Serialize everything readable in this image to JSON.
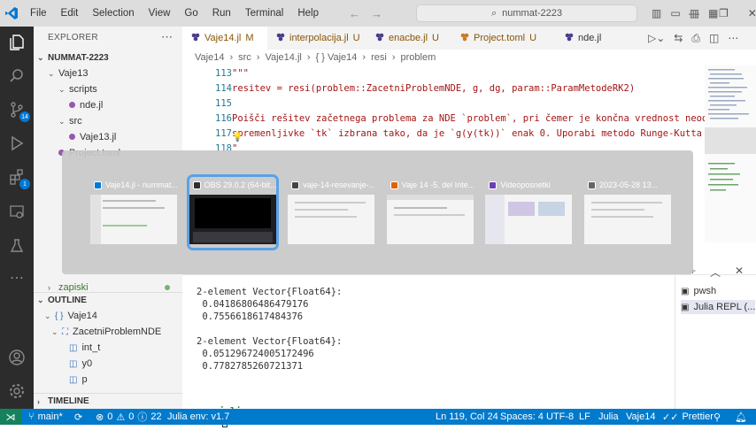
{
  "menu": [
    "File",
    "Edit",
    "Selection",
    "View",
    "Go",
    "Run",
    "Terminal",
    "Help"
  ],
  "search": {
    "text": "nummat-2223"
  },
  "explorer": {
    "title": "EXPLORER",
    "project": "NUMMAT-2223",
    "rows": [
      {
        "label": "Vaje13",
        "indent": 1,
        "arrow": "⌄"
      },
      {
        "label": "scripts",
        "indent": 2,
        "arrow": "⌄"
      },
      {
        "label": "nde.jl",
        "indent": 3,
        "arrow": ""
      },
      {
        "label": "src",
        "indent": 2,
        "arrow": "⌄"
      },
      {
        "label": "Vaje13.jl",
        "indent": 3,
        "arrow": ""
      },
      {
        "label": "Project.toml",
        "indent": 2,
        "arrow": ""
      }
    ],
    "zapiski": "zapiski",
    "outline_title": "OUTLINE",
    "outline": [
      {
        "label": "Vaje14",
        "indent": 1,
        "icon": "{ }"
      },
      {
        "label": "ZacetniProblemNDE",
        "indent": 2,
        "icon": "⛶"
      },
      {
        "label": "int_t",
        "indent": 3,
        "icon": "◫"
      },
      {
        "label": "y0",
        "indent": 3,
        "icon": "◫"
      },
      {
        "label": "p",
        "indent": 3,
        "icon": "◫"
      }
    ],
    "timeline": "TIMELINE"
  },
  "tabs": [
    {
      "label": "Vaje14.jl",
      "mark": "M",
      "active": true,
      "color": "#4a3b8c"
    },
    {
      "label": "interpolacija.jl",
      "mark": "U",
      "active": false,
      "color": "#4a3b8c"
    },
    {
      "label": "enacbe.jl",
      "mark": "U",
      "active": false,
      "color": "#4a3b8c"
    },
    {
      "label": "Project.toml",
      "mark": "U",
      "active": false,
      "color": "#c97b1e"
    },
    {
      "label": "nde.jl",
      "mark": "",
      "active": false,
      "color": "#4a3b8c"
    }
  ],
  "breadcrumb": [
    "Vaje14",
    "src",
    "Vaje14.jl",
    "{ } Vaje14",
    "resi",
    "problem"
  ],
  "code": [
    {
      "n": "113",
      "text": "\"\"\""
    },
    {
      "n": "114",
      "text": "    resitev = resi(problem::ZacetniProblemNDE, g, dg, param::ParamMetodeRK2)"
    },
    {
      "n": "115",
      "text": ""
    },
    {
      "n": "116",
      "text": "Poišči rešitev začetnega problema za NDE `problem`, pri čemer je končna vrednost neodvi"
    },
    {
      "n": "117",
      "text": "spremenljivke `tk` izbrana tako, da je `g(y(tk))` enak 0. Uporabi metodo Runge-Kutta re"
    },
    {
      "n": "118",
      "text": "\""
    }
  ],
  "switcher": [
    {
      "title": "Vaje14.jl - nummat...",
      "selected": false,
      "icon": "vscode"
    },
    {
      "title": "OBS 29.0.2 (64-bit...",
      "selected": true,
      "icon": "obs"
    },
    {
      "title": "vaje-14-resevanje-...",
      "selected": false,
      "icon": "doc"
    },
    {
      "title": "Vaje 14 -5. del Inte...",
      "selected": false,
      "icon": "firefox"
    },
    {
      "title": "Videoposnetki",
      "selected": false,
      "icon": "video"
    },
    {
      "title": "2023-05-28 13...",
      "selected": false,
      "icon": "file"
    }
  ],
  "terminal": {
    "lines": [
      "2-element Vector{Float64}:",
      " 0.04186806486479176",
      " 0.7556618617484376",
      "",
      "2-element Vector{Float64}:",
      " 0.051296724005172496",
      " 0.7782785260721371",
      "",
      ""
    ],
    "prompt": "julia>",
    "list": [
      "pwsh",
      "Julia REPL (..."
    ]
  },
  "status": {
    "branch": "main*",
    "errors": "0",
    "warnings": "0",
    "info": "22",
    "env": "Julia env: v1.7",
    "position": "Ln 119, Col 24",
    "spaces": "Spaces: 4",
    "encoding": "UTF-8",
    "eol": "LF",
    "language": "Julia",
    "project": "Vaje14",
    "prettier": "Prettier"
  },
  "colors": {
    "statusbar": "#007acc",
    "accent": "#0078d4",
    "activity": "#2c2c2c"
  }
}
